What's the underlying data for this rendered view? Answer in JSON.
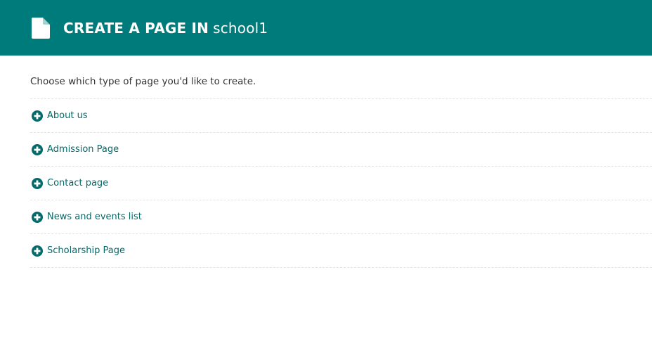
{
  "header": {
    "title_prefix": "CREATE A PAGE IN",
    "site_name": "school1",
    "icon": "file-icon",
    "background_color": "#007b7b"
  },
  "main": {
    "intro": "Choose which type of page you'd like to create.",
    "items": [
      {
        "label": "About us",
        "icon": "plus-circle-icon"
      },
      {
        "label": "Admission Page",
        "icon": "plus-circle-icon"
      },
      {
        "label": "Contact page",
        "icon": "plus-circle-icon"
      },
      {
        "label": "News and events list",
        "icon": "plus-circle-icon"
      },
      {
        "label": "Scholarship Page",
        "icon": "plus-circle-icon"
      }
    ],
    "accent_color": "#046a6a"
  }
}
